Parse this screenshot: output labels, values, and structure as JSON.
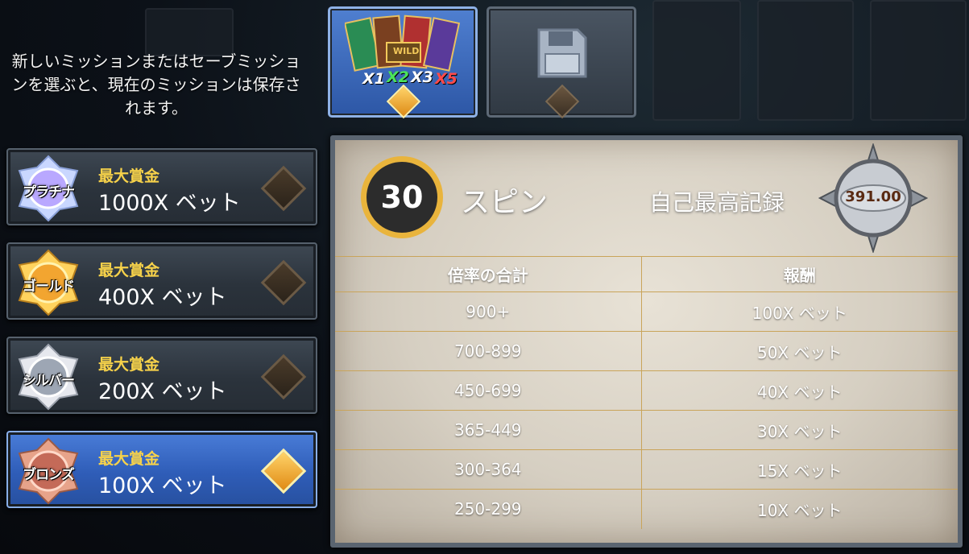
{
  "info_text": "新しいミッションまたはセーブミッションを選ぶと、現在のミッションは保存されます。",
  "missions": [
    {
      "medal": "プラチナ",
      "title": "最大賞金",
      "value": "1000X ベット",
      "selected": false
    },
    {
      "medal": "ゴールド",
      "title": "最大賞金",
      "value": "400X ベット",
      "selected": false
    },
    {
      "medal": "シルバー",
      "title": "最大賞金",
      "value": "200X ベット",
      "selected": false
    },
    {
      "medal": "ブロンズ",
      "title": "最大賞金",
      "value": "100X ベット",
      "selected": true
    }
  ],
  "cards": {
    "multiplier_labels": [
      "X1",
      "X2",
      "X3",
      "X5"
    ],
    "wild_text": "WILD",
    "save_icon": "floppy-disk-icon"
  },
  "panel": {
    "spins_count": "30",
    "spins_label": "スピン",
    "best_label": "自己最高記録",
    "best_value": "391.00",
    "table_headers": [
      "倍率の合計",
      "報酬"
    ],
    "rows": [
      [
        "900+",
        "100X ベット"
      ],
      [
        "700-899",
        "50X ベット"
      ],
      [
        "450-699",
        "40X ベット"
      ],
      [
        "365-449",
        "30X ベット"
      ],
      [
        "300-364",
        "15X ベット"
      ],
      [
        "250-299",
        "10X ベット"
      ]
    ]
  },
  "colors": {
    "gold": "#f7d24a",
    "selected_blue": "#2f5db8",
    "panel_paper": "#d6cfc2",
    "divider": "#c9a45a"
  }
}
